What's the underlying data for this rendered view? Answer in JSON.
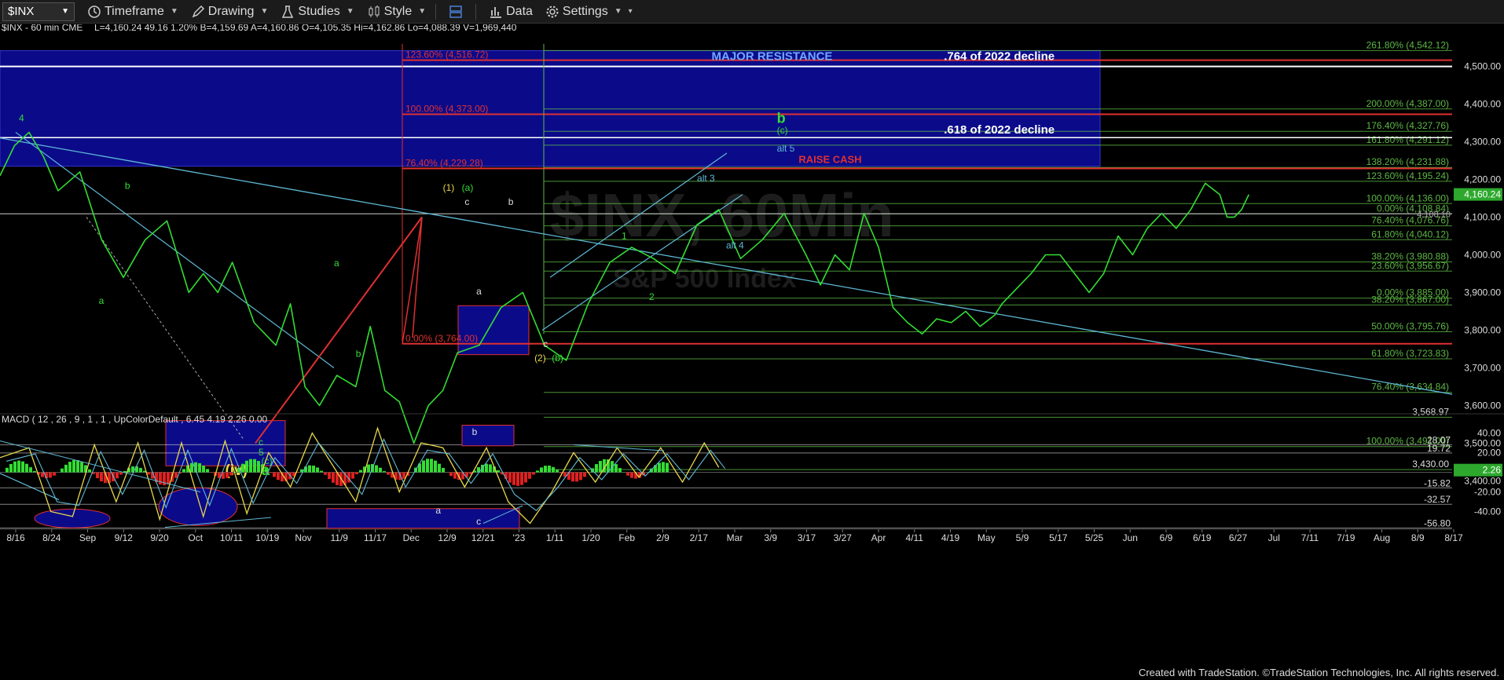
{
  "toolbar": {
    "symbol": "$INX",
    "timeframe": "Timeframe",
    "drawing": "Drawing",
    "studies": "Studies",
    "style": "Style",
    "data": "Data",
    "settings": "Settings"
  },
  "header": {
    "symbol_line": "$INX - 60 min  CME",
    "ohlc": "L=4,160.24  49.16  1.20%  B=4,159.69  A=4,160.86  O=4,105.35  Hi=4,162.86  Lo=4,088.39  V=1,969,440"
  },
  "watermark": {
    "title": "$INX, 60Min",
    "subtitle": "S&P 500 Index"
  },
  "colors": {
    "fib_green": "#5db844",
    "fib_red": "#e03030",
    "price_green": "#33dd33",
    "box_blue": "#0b0b8a",
    "trend_cyan": "#5fb9d6",
    "label_yellow": "#e8d84a"
  },
  "chart_data": [
    {
      "type": "line",
      "title": "",
      "ylim": [
        3330,
        4570
      ],
      "y_ticks": [
        "4,500.00",
        "4,400.00",
        "4,300.00",
        "4,200.00",
        "4,100.00",
        "4,000.00",
        "3,900.00",
        "3,800.00",
        "3,700.00",
        "3,600.00",
        "3,500.00",
        "3,400.00"
      ],
      "y_tick_values": [
        4500,
        4400,
        4300,
        4200,
        4100,
        4000,
        3900,
        3800,
        3700,
        3600,
        3500,
        3400
      ],
      "x_ticks": [
        "8/16",
        "8/24",
        "Sep",
        "9/12",
        "9/20",
        "Oct",
        "10/11",
        "10/19",
        "Nov",
        "11/9",
        "11/17",
        "Dec",
        "12/9",
        "12/21",
        "'23",
        "1/11",
        "1/20",
        "Feb",
        "2/9",
        "2/17",
        "Mar",
        "3/9",
        "3/17",
        "3/27",
        "Apr",
        "4/11",
        "4/19",
        "May",
        "5/9",
        "5/17",
        "5/25",
        "Jun",
        "6/9",
        "6/19",
        "6/27",
        "Jul",
        "7/11",
        "7/19",
        "Aug",
        "8/9",
        "8/17"
      ],
      "price_series": {
        "name": "$INX 60 min",
        "x": [
          0,
          0.01,
          0.02,
          0.03,
          0.04,
          0.055,
          0.07,
          0.085,
          0.1,
          0.115,
          0.13,
          0.14,
          0.15,
          0.16,
          0.175,
          0.19,
          0.2,
          0.21,
          0.22,
          0.232,
          0.245,
          0.255,
          0.265,
          0.275,
          0.285,
          0.295,
          0.305,
          0.315,
          0.33,
          0.345,
          0.36,
          0.375,
          0.39,
          0.405,
          0.42,
          0.435,
          0.45,
          0.465,
          0.48,
          0.495,
          0.51,
          0.525,
          0.54,
          0.555,
          0.565,
          0.575,
          0.585,
          0.595,
          0.605,
          0.615,
          0.625,
          0.635,
          0.645,
          0.655,
          0.665,
          0.675,
          0.685,
          0.69,
          0.7,
          0.71,
          0.72,
          0.73,
          0.74,
          0.75,
          0.76,
          0.77,
          0.78,
          0.79,
          0.8,
          0.81,
          0.82,
          0.83,
          0.84,
          0.845,
          0.85,
          0.855,
          0.86
        ],
        "values": [
          4210,
          4290,
          4325,
          4260,
          4170,
          4220,
          4040,
          3940,
          4040,
          4090,
          3900,
          3950,
          3900,
          3980,
          3820,
          3760,
          3870,
          3650,
          3600,
          3680,
          3650,
          3810,
          3640,
          3610,
          3500,
          3600,
          3640,
          3740,
          3760,
          3860,
          3900,
          3760,
          3720,
          3870,
          3980,
          4020,
          3990,
          3950,
          4080,
          4120,
          3990,
          4040,
          4110,
          4000,
          3920,
          4000,
          3960,
          4110,
          4020,
          3860,
          3820,
          3790,
          3830,
          3820,
          3850,
          3810,
          3840,
          3870,
          3910,
          3950,
          4000,
          4000,
          3950,
          3900,
          3950,
          4050,
          4000,
          4070,
          4110,
          4070,
          4120,
          4190,
          4160,
          4100,
          4100,
          4120,
          4160
        ]
      },
      "price_labels": [
        "4,160.24",
        "4,108.10"
      ],
      "fib_levels_green": [
        {
          "label": "261.80% (4,542.12)",
          "value": 4542.12
        },
        {
          "label": "200.00% (4,387.00)",
          "value": 4387
        },
        {
          "label": "176.40% (4,327.76)",
          "value": 4327.76
        },
        {
          "label": "161.80% (4,291.12)",
          "value": 4291.12
        },
        {
          "label": "138.20% (4,231.88)",
          "value": 4231.88
        },
        {
          "label": "123.60% (4,195.24)",
          "value": 4195.24
        },
        {
          "label": "100.00% (4,136.00)",
          "value": 4136
        },
        {
          "label": "0.00% (4,108.84)",
          "value": 4108.84
        },
        {
          "label": "76.40% (4,076.76)",
          "value": 4076.76
        },
        {
          "label": "61.80% (4,040.12)",
          "value": 4040.12
        },
        {
          "label": "38.20% (3,980.88)",
          "value": 3980.88
        },
        {
          "label": "23.60% (3,956.67)",
          "value": 3956.67
        },
        {
          "label": "0.00% (3,885.00)",
          "value": 3885
        },
        {
          "label": "38.20% (3,867.00)",
          "value": 3867
        },
        {
          "label": "50.00% (3,795.76)",
          "value": 3795.76
        },
        {
          "label": "61.80% (3,723.83)",
          "value": 3723.83
        },
        {
          "label": "76.40% (3,634.84)",
          "value": 3634.84
        },
        {
          "label": "3,568.97",
          "value": 3568.97
        },
        {
          "label": "100.00% (3,491.00)",
          "value": 3491
        },
        {
          "label": "3,430.00",
          "value": 3430
        }
      ],
      "fib_levels_red": [
        {
          "label": "123.60% (4,516.72)",
          "value": 4516.72
        },
        {
          "label": "100.00% (4,373.00)",
          "value": 4373
        },
        {
          "label": "76.40% (4,229.28)",
          "value": 4229.28
        },
        {
          "label": "0.00% (3,764.00)",
          "value": 3764
        }
      ],
      "annotations": [
        {
          "text": "MAJOR RESISTANCE",
          "x": 0.49,
          "y": 4517
        },
        {
          "text": ".764 of 2022 decline",
          "x": 0.65,
          "y": 4517
        },
        {
          "text": ".618 of 2022 decline",
          "x": 0.65,
          "y": 4322
        },
        {
          "text": "RAISE CASH",
          "x": 0.55,
          "y": 4244
        },
        {
          "text": "alt 5",
          "x": 0.535,
          "y": 4274
        },
        {
          "text": "alt 3",
          "x": 0.48,
          "y": 4195
        },
        {
          "text": "alt 4",
          "x": 0.5,
          "y": 4017
        },
        {
          "text": "b",
          "x": 0.535,
          "y": 4350
        },
        {
          "text": "(c)",
          "x": 0.535,
          "y": 4322
        },
        {
          "text": "(1)",
          "x": 0.305,
          "y": 4170
        },
        {
          "text": "(a)",
          "x": 0.318,
          "y": 4170
        },
        {
          "text": "(2)",
          "x": 0.368,
          "y": 3718
        },
        {
          "text": "(b)",
          "x": 0.38,
          "y": 3718
        },
        {
          "text": "(iv)",
          "x": 0.155,
          "y": 3415
        },
        {
          "text": "a",
          "x": 0.18,
          "y": 3415
        },
        {
          "text": "(c)",
          "x": 0.18,
          "y": 3445
        },
        {
          "text": "5",
          "x": 0.178,
          "y": 3468
        },
        {
          "text": "c",
          "x": 0.178,
          "y": 3495
        },
        {
          "text": "4",
          "x": 0.013,
          "y": 4354
        },
        {
          "text": "b",
          "x": 0.086,
          "y": 4175
        },
        {
          "text": "a",
          "x": 0.068,
          "y": 3870
        },
        {
          "text": "a",
          "x": 0.23,
          "y": 3970
        },
        {
          "text": "b",
          "x": 0.245,
          "y": 3729
        },
        {
          "text": "c",
          "x": 0.32,
          "y": 4132
        },
        {
          "text": "b",
          "x": 0.35,
          "y": 4132
        },
        {
          "text": "a",
          "x": 0.328,
          "y": 3895
        },
        {
          "text": "c",
          "x": 0.374,
          "y": 3755
        },
        {
          "text": "1",
          "x": 0.428,
          "y": 4042
        },
        {
          "text": "2",
          "x": 0.447,
          "y": 3880
        }
      ]
    },
    {
      "type": "line",
      "title": "MACD ( 12 , 26 , 9 , 1 , 1 , UpColorDefault , 6.45  4.19  2.26  0.00",
      "legend_values": [
        "6.45",
        "4.19",
        "2.26",
        "0.00"
      ],
      "ylim": [
        -58,
        50
      ],
      "y_ticks": [
        "40.00",
        "20.00",
        "-20.00",
        "-40.00"
      ],
      "y_tick_values": [
        40,
        20,
        -20,
        -40
      ],
      "level_labels": [
        "28.07",
        "19.72",
        "-15.82",
        "-32.57",
        "-56.80"
      ],
      "level_values": [
        28.07,
        19.72,
        -15.82,
        -32.57,
        -56.8
      ],
      "current_label": "2.26",
      "macd_line": {
        "x": [
          0,
          0.02,
          0.035,
          0.05,
          0.065,
          0.08,
          0.095,
          0.11,
          0.125,
          0.14,
          0.155,
          0.17,
          0.185,
          0.2,
          0.215,
          0.23,
          0.245,
          0.26,
          0.275,
          0.29,
          0.305,
          0.32,
          0.335,
          0.35,
          0.365,
          0.38,
          0.395,
          0.41,
          0.425,
          0.44,
          0.455,
          0.47,
          0.485,
          0.495
        ],
        "values": [
          15,
          25,
          -40,
          -45,
          28,
          -30,
          30,
          -48,
          30,
          -45,
          32,
          -42,
          20,
          -15,
          40,
          5,
          -30,
          45,
          -20,
          30,
          25,
          -15,
          25,
          -30,
          -52,
          -20,
          20,
          -10,
          25,
          -5,
          25,
          -10,
          30,
          5
        ]
      },
      "labels": [
        {
          "text": "b",
          "x": 0.325,
          "y": 38
        },
        {
          "text": "a",
          "x": 0.3,
          "y": -42
        },
        {
          "text": "c",
          "x": 0.328,
          "y": -53
        }
      ]
    }
  ],
  "footer": "Created with TradeStation. ©TradeStation Technologies, Inc. All rights reserved."
}
